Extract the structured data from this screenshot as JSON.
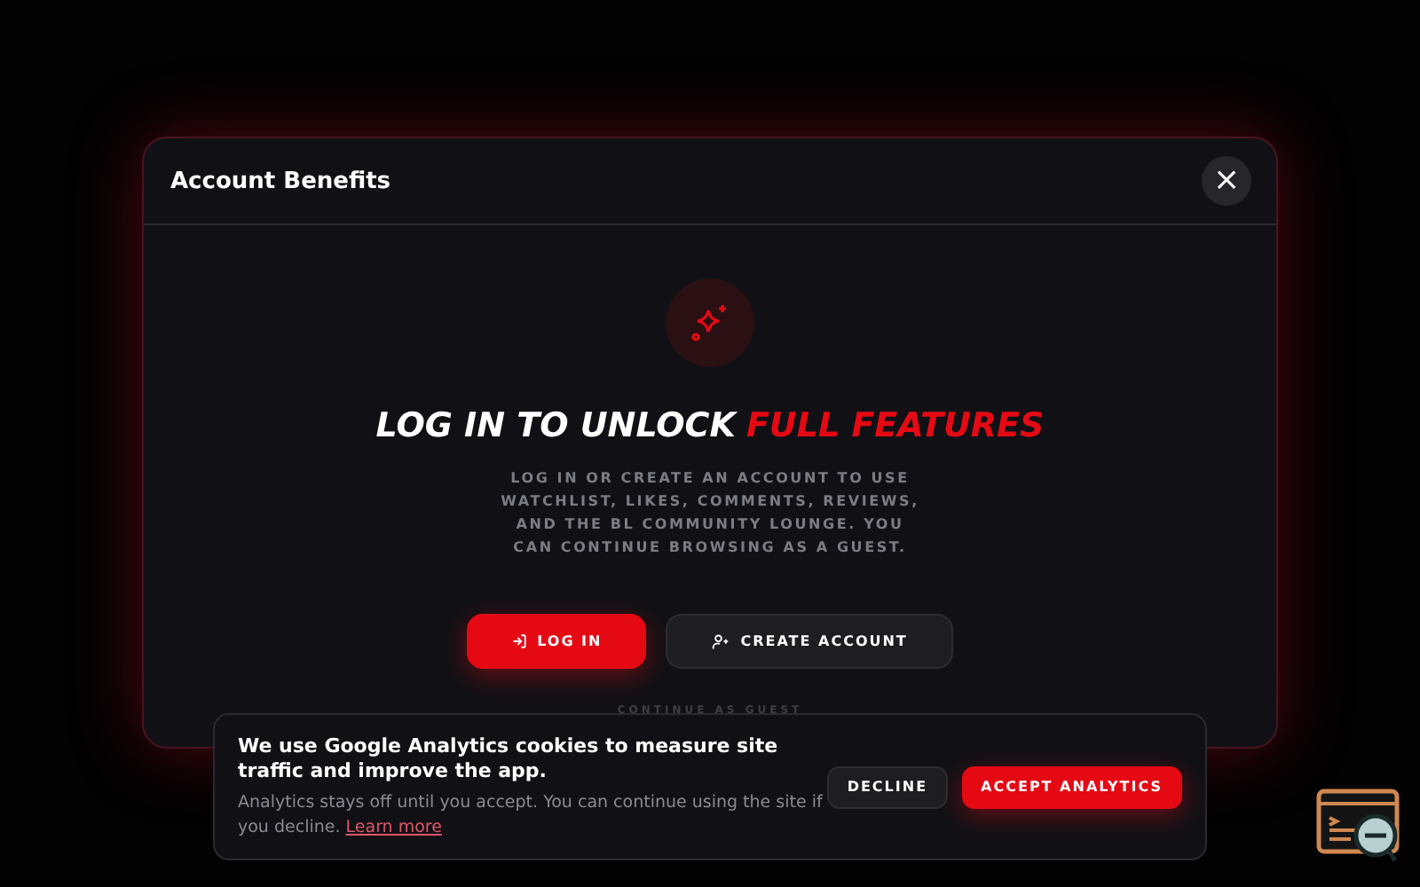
{
  "modal": {
    "title": "Account Benefits",
    "close_label": "×",
    "headline": {
      "lead": "LOG IN TO UNLOCK",
      "highlight": "FULL FEATURES"
    },
    "description": "LOG IN OR CREATE AN ACCOUNT TO USE WATCHLIST, LIKES, COMMENTS, REVIEWS, AND THE BL COMMUNITY LOUNGE. YOU CAN CONTINUE BROWSING AS A GUEST.",
    "buttons": [
      {
        "label": "LOG IN",
        "kind": "primary"
      },
      {
        "label": "CREATE ACCOUNT",
        "kind": "secondary"
      }
    ],
    "guest_link": "CONTINUE AS GUEST"
  },
  "cookie_banner": {
    "heading": "We use Google Analytics cookies to measure site traffic and improve the app.",
    "body": "Analytics stays off until you accept. You can continue using the site if you decline.",
    "link": "Learn more",
    "buttons": [
      {
        "label": "DECLINE",
        "kind": "secondary"
      },
      {
        "label": "ACCEPT ANALYTICS",
        "kind": "primary"
      }
    ]
  }
}
